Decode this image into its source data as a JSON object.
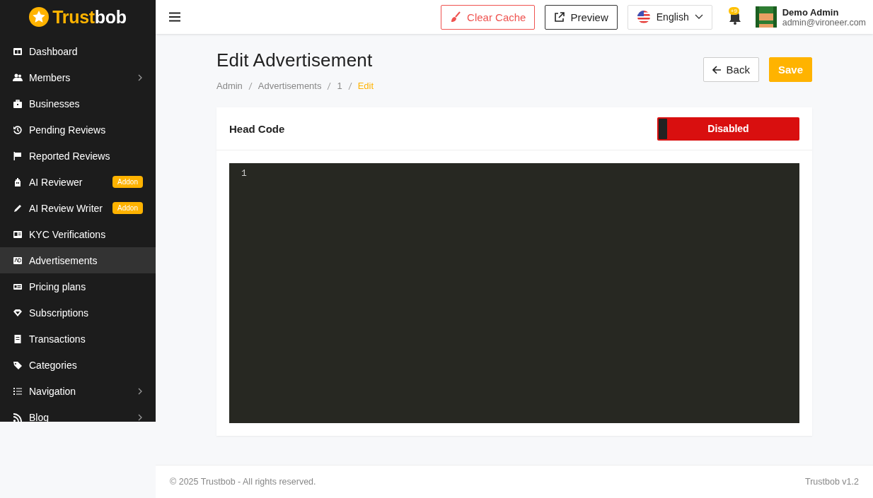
{
  "logo": {
    "part_1": "Trust",
    "part_2": "bob"
  },
  "sidebar": {
    "items": [
      {
        "label": "Dashboard",
        "selected": false,
        "expandable": false
      },
      {
        "label": "Members",
        "selected": false,
        "expandable": true
      },
      {
        "label": "Businesses",
        "selected": false,
        "expandable": false
      },
      {
        "label": "Pending Reviews",
        "selected": false,
        "expandable": false
      },
      {
        "label": "Reported Reviews",
        "selected": false,
        "expandable": false
      },
      {
        "label": "AI Reviewer",
        "selected": false,
        "expandable": false,
        "badge": "Addon"
      },
      {
        "label": "AI Review Writer",
        "selected": false,
        "expandable": false,
        "badge": "Addon"
      },
      {
        "label": "KYC Verifications",
        "selected": false,
        "expandable": false
      },
      {
        "label": "Advertisements",
        "selected": true,
        "expandable": false
      },
      {
        "label": "Pricing plans",
        "selected": false,
        "expandable": false
      },
      {
        "label": "Subscriptions",
        "selected": false,
        "expandable": false
      },
      {
        "label": "Transactions",
        "selected": false,
        "expandable": false
      },
      {
        "label": "Categories",
        "selected": false,
        "expandable": false
      },
      {
        "label": "Navigation",
        "selected": false,
        "expandable": true
      },
      {
        "label": "Blog",
        "selected": false,
        "expandable": true
      }
    ]
  },
  "topbar": {
    "clear_cache": "Clear Cache",
    "preview": "Preview",
    "language": "English",
    "notification_count": "+9",
    "user": {
      "name": "Demo Admin",
      "email": "admin@vironeer.com"
    }
  },
  "page": {
    "title": "Edit Advertisement",
    "breadcrumb": [
      {
        "label": "Admin",
        "selected": false
      },
      {
        "label": "Advertisements",
        "selected": false
      },
      {
        "label": "1",
        "selected": false
      },
      {
        "label": "Edit",
        "selected": true
      }
    ],
    "back": "Back",
    "save": "Save"
  },
  "card": {
    "title": "Head Code",
    "toggle": {
      "label": "Disabled",
      "on": false
    },
    "editor": {
      "line_numbers": [
        "1"
      ]
    }
  },
  "footer": {
    "copyright": "© 2025 Trustbob - All rights reserved.",
    "version": "Trustbob v1.2"
  }
}
